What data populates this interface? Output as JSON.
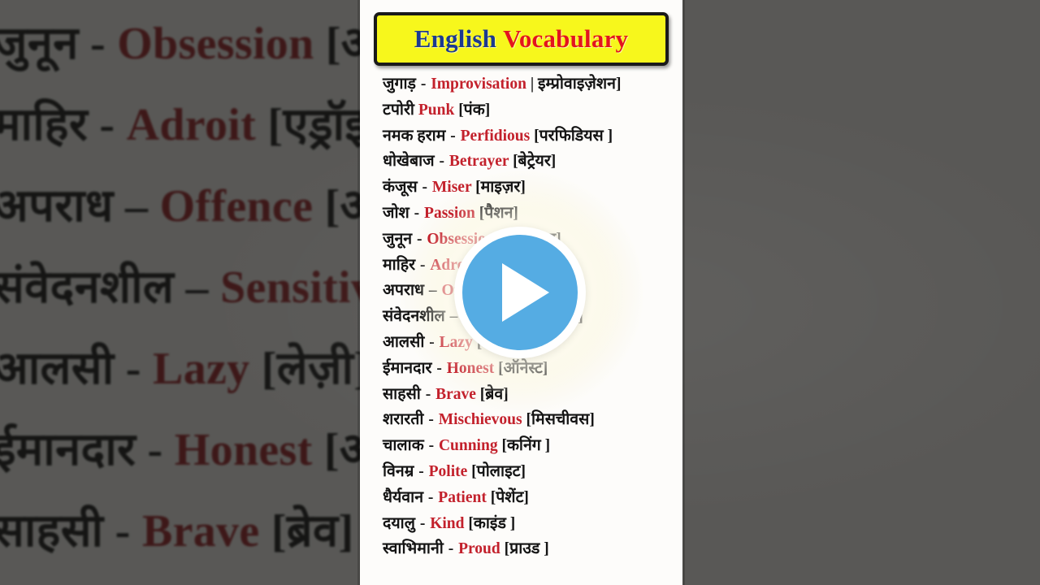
{
  "header": {
    "title_word1": "English",
    "title_word2": "Vocabulary",
    "banner_bg": "#f7f71c",
    "word1_color": "#1d3a8f",
    "word2_color": "#e3141e"
  },
  "theme": {
    "english_word_color": "#c3212c",
    "hindi_text_color": "#141414",
    "card_bg": "#fdfcfa",
    "play_button_color": "#55ace3"
  },
  "player": {
    "play_icon": "play-triangle-icon",
    "state": "paused"
  },
  "vocabulary": [
    {
      "hindi": "जुगाड़",
      "sep": "-",
      "english": "Improvisation",
      "transliteration": "| इम्प्रोवाइज़ेशन]"
    },
    {
      "hindi": "टपोरी",
      "sep": "",
      "english": "Punk",
      "transliteration": "[पंक]"
    },
    {
      "hindi": "नमक हराम",
      "sep": "-",
      "english": "Perfidious",
      "transliteration": "[परफिडियस ]"
    },
    {
      "hindi": "धोखेबाज",
      "sep": "-",
      "english": "Betrayer",
      "transliteration": "[बेट्रेयर]"
    },
    {
      "hindi": "कंजूस",
      "sep": "-",
      "english": "Miser",
      "transliteration": "[माइज़र]"
    },
    {
      "hindi": "जोश",
      "sep": "-",
      "english": "Passion",
      "transliteration": "[पैशन]"
    },
    {
      "hindi": "जुनून",
      "sep": "-",
      "english": "Obsession",
      "transliteration": "[ऑब्सेशन]"
    },
    {
      "hindi": "माहिर",
      "sep": "-",
      "english": "Adroit",
      "transliteration": "[एड्रॉइट]"
    },
    {
      "hindi": "अपराध",
      "sep": "–",
      "english": "Offence",
      "transliteration": "[ऑफेंस]"
    },
    {
      "hindi": "संवेदनशील",
      "sep": "–",
      "english": "Sensitive",
      "transliteration": "[सेंसिटिव]"
    },
    {
      "hindi": "आलसी",
      "sep": "-",
      "english": "Lazy",
      "transliteration": "[लेज़ी]"
    },
    {
      "hindi": "ईमानदार",
      "sep": "-",
      "english": "Honest",
      "transliteration": "[ऑनेस्ट]"
    },
    {
      "hindi": "साहसी",
      "sep": "-",
      "english": "Brave",
      "transliteration": "[ब्रेव]"
    },
    {
      "hindi": "शरारती",
      "sep": "-",
      "english": "Mischievous",
      "transliteration": "[मिसचीवस]"
    },
    {
      "hindi": "चालाक",
      "sep": "-",
      "english": "Cunning",
      "transliteration": "[कनिंग ]"
    },
    {
      "hindi": "विनम्र",
      "sep": "-",
      "english": "Polite",
      "transliteration": "[पोलाइट]"
    },
    {
      "hindi": "धैर्यवान",
      "sep": "-",
      "english": "Patient",
      "transliteration": "[पेशेंट]"
    },
    {
      "hindi": "दयालु",
      "sep": "-",
      "english": "Kind",
      "transliteration": "[काइंड ]"
    },
    {
      "hindi": "स्वाभिमानी",
      "sep": "-",
      "english": "Proud",
      "transliteration": "[प्राउड ]"
    }
  ],
  "background_rows": [
    {
      "hindi": "जोश",
      "sep": "-",
      "english": "Passion",
      "transliteration": "[पैशन]"
    },
    {
      "hindi": "जुनून",
      "sep": "-",
      "english": "Obsession",
      "transliteration": "[ऑब्सेशन]"
    },
    {
      "hindi": "माहिर",
      "sep": "-",
      "english": "Adroit",
      "transliteration": "[एड्रॉइट]"
    },
    {
      "hindi": "अपराध",
      "sep": "–",
      "english": "Offence",
      "transliteration": "[ऑफेंस]"
    },
    {
      "hindi": "संवेदनशील",
      "sep": "–",
      "english": "Sensitive",
      "transliteration": "[सेंसिटिव]"
    },
    {
      "hindi": "आलसी",
      "sep": "-",
      "english": "Lazy",
      "transliteration": "[लेज़ी]"
    },
    {
      "hindi": "ईमानदार",
      "sep": "-",
      "english": "Honest",
      "transliteration": "[ऑनेस्ट]"
    },
    {
      "hindi": "साहसी",
      "sep": "-",
      "english": "Brave",
      "transliteration": "[ब्रेव]"
    }
  ]
}
